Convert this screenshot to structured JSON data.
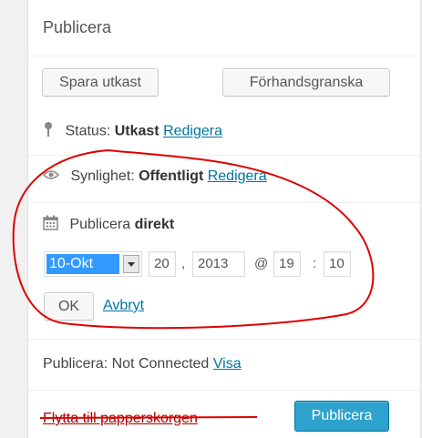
{
  "box": {
    "title": "Publicera",
    "save_draft": "Spara utkast",
    "preview": "Förhandsgranska",
    "status": {
      "label": "Status:",
      "value": "Utkast",
      "edit": "Redigera"
    },
    "visibility": {
      "label": "Synlighet:",
      "value": "Offentligt",
      "edit": "Redigera"
    },
    "schedule": {
      "label": "Publicera",
      "value": "direkt",
      "month": "10-Okt",
      "day": "20",
      "year": "2013",
      "at": "@",
      "hour": "19",
      "minute": "10",
      "ok": "OK",
      "cancel": "Avbryt"
    },
    "connection": {
      "label": "Publicera: Not Connected",
      "view": "Visa"
    },
    "trash": "Flytta till papperskorgen",
    "publish": "Publicera"
  },
  "colors": {
    "link": "#0074a2",
    "trash": "#aa0000",
    "publish": "#2ea2cc",
    "annotation": "#e00000",
    "selection": "#3399ff"
  }
}
